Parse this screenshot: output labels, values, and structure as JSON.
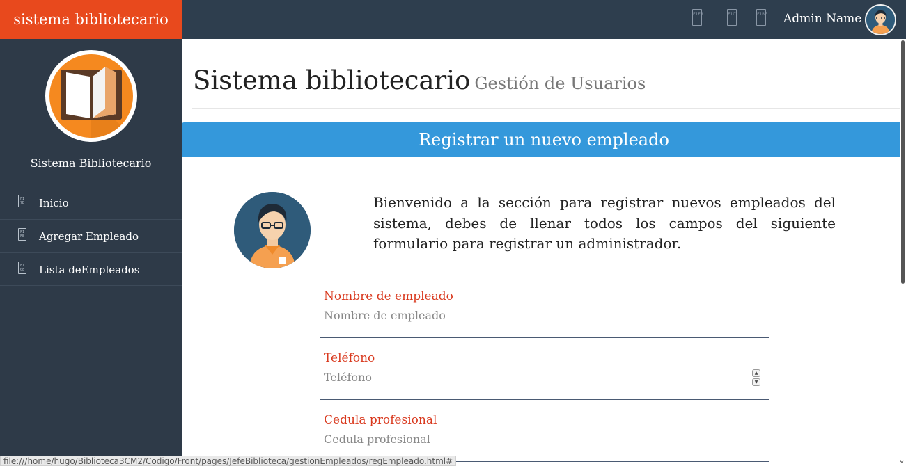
{
  "topbar": {
    "brand": "sistema bibliotecario",
    "icons": [
      {
        "name": "glyph-icon-1",
        "glyph": "F1F6"
      },
      {
        "name": "glyph-icon-2",
        "glyph": "F1C3"
      },
      {
        "name": "glyph-icon-3",
        "glyph": "F1BF"
      }
    ],
    "admin_name": "Admin Name"
  },
  "sidebar": {
    "title": "Sistema Bibliotecario",
    "items": [
      {
        "label": "Inicio",
        "glyph": "F1 7D"
      },
      {
        "label": "Agregar Empleado",
        "glyph": "F1 FE"
      },
      {
        "label": "Lista deEmpleados",
        "glyph": "F1 08"
      }
    ]
  },
  "main": {
    "title": "Sistema bibliotecario",
    "subtitle": "Gestión de Usuarios",
    "panel_title": "Registrar un nuevo empleado",
    "intro": "Bienvenido a la sección para registrar nuevos empleados del sistema, debes de llenar todos los campos del siguiente formulario para registrar un administrador.",
    "fields": [
      {
        "label": "Nombre de empleado",
        "placeholder": "Nombre de empleado"
      },
      {
        "label": "Teléfono",
        "placeholder": "Teléfono"
      },
      {
        "label": "Cedula profesional",
        "placeholder": "Cedula profesional"
      }
    ]
  },
  "statusbar": {
    "url": "file:///home/hugo/Biblioteca3CM2/Codigo/Front/pages/JefeBiblioteca/gestionEmpleados/regEmpleado.html#"
  },
  "colors": {
    "brand": "#e8491d",
    "topbar": "#2e3e4e",
    "sidebar": "#2e3a48",
    "panel": "#3498db",
    "label": "#d9391e"
  }
}
